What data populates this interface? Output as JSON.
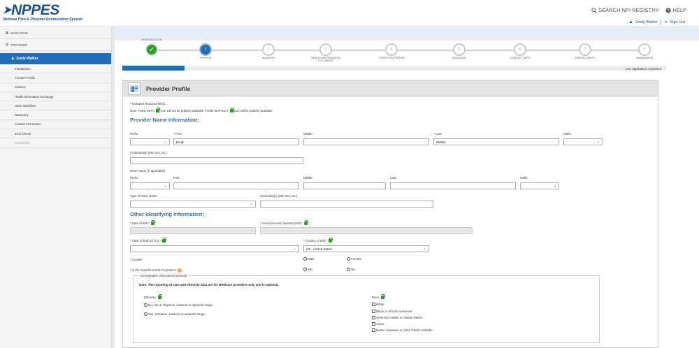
{
  "header": {
    "logo_text": "NPPES",
    "logo_sub": "National Plan & Provider Enumeration System",
    "search_label": "SEARCH NPI REGISTRY",
    "help_label": "HELP",
    "user_name": "Emily Walker",
    "sign_out": "Sign Out"
  },
  "sidebar": {
    "main_page": "MAIN PAGE",
    "provider": "PROVIDER",
    "active_user": "Emily Walker",
    "items": [
      "Introduction",
      "Provider Profile",
      "Address",
      "Health Information Exchange",
      "Other Identifiers",
      "Taxonomy",
      "Contact Information",
      "Error Check",
      "Submission"
    ]
  },
  "stepper": {
    "steps": [
      {
        "num": "",
        "label": "INTRODUCTION"
      },
      {
        "num": "1",
        "label": "PROFILE"
      },
      {
        "num": "2",
        "label": "ADDRESS"
      },
      {
        "num": "3",
        "label": "HEALTH INFORMATION EXCHANGE"
      },
      {
        "num": "4",
        "label": "OTHER IDENTIFIERS"
      },
      {
        "num": "5",
        "label": "TAXONOMY"
      },
      {
        "num": "6",
        "label": "CONTACT INFO"
      },
      {
        "num": "7",
        "label": "ERROR CHECK"
      },
      {
        "num": "8",
        "label": "SUBMISSION"
      }
    ],
    "progress_percent": 11.5,
    "progress_text": "13% application completed"
  },
  "panel": {
    "title": "Provider Profile",
    "required_note": "* Indicates Required fields.",
    "lock_note_a": "Note: Fields WITH",
    "lock_note_b": "icon will not be publicly available. Fields WITHOUT",
    "lock_note_c": "icon will be publicly available.",
    "name_section": "Provider Name Information:",
    "prefix_label": "Prefix:",
    "first_label": "* First:",
    "middle_label": "Middle:",
    "last_label": "* Last:",
    "suffix_label": "Suffix:",
    "first_value": "Emily",
    "last_value": "Walker",
    "credential_label": "Credential(s) (MD, DO, etc.)",
    "other_name_label": "Other Name (If applicable)",
    "o_prefix_label": "Prefix:",
    "o_first_label": "First:",
    "o_middle_label": "Middle:",
    "o_last_label": "Last:",
    "o_suffix_label": "Suffix:",
    "type_other_label": "Type of Other Name:",
    "o_credential_label": "Credential(s) (MD, DO, etc.)",
    "other_section": "Other Identifying Information:",
    "dob_label": "* Date of Birth:",
    "ssn_label": "* Social Security Number(SSN):",
    "state_label": "* State of Birth (If U.S.)",
    "country_label": "* Country of Birth:",
    "country_value": "US - United States",
    "gender_label": "* Gender:",
    "male": "Male",
    "female": "Female",
    "sole_label": "* Is the Provider a Sole Proprietor?",
    "yes": "Yes",
    "no": "No",
    "demo_legend": "Demographic Information(optional)",
    "demo_note": "Note: The reporting of race and ethnicity data are for Medicare providers only and is optional.",
    "ethnicity_label": "Ethnicity:",
    "eth_opt1": "No, not of Hispanic, Latino/a or Spanish Origin",
    "eth_opt2": "Yes, Hispanic, Latino/a or Spanish Origin",
    "race_label": "Race:",
    "races": [
      "White",
      "Black or African American",
      "American Indian or Alaska Native",
      "Asian",
      "Native Hawaiian or other Pacific Islander"
    ]
  }
}
